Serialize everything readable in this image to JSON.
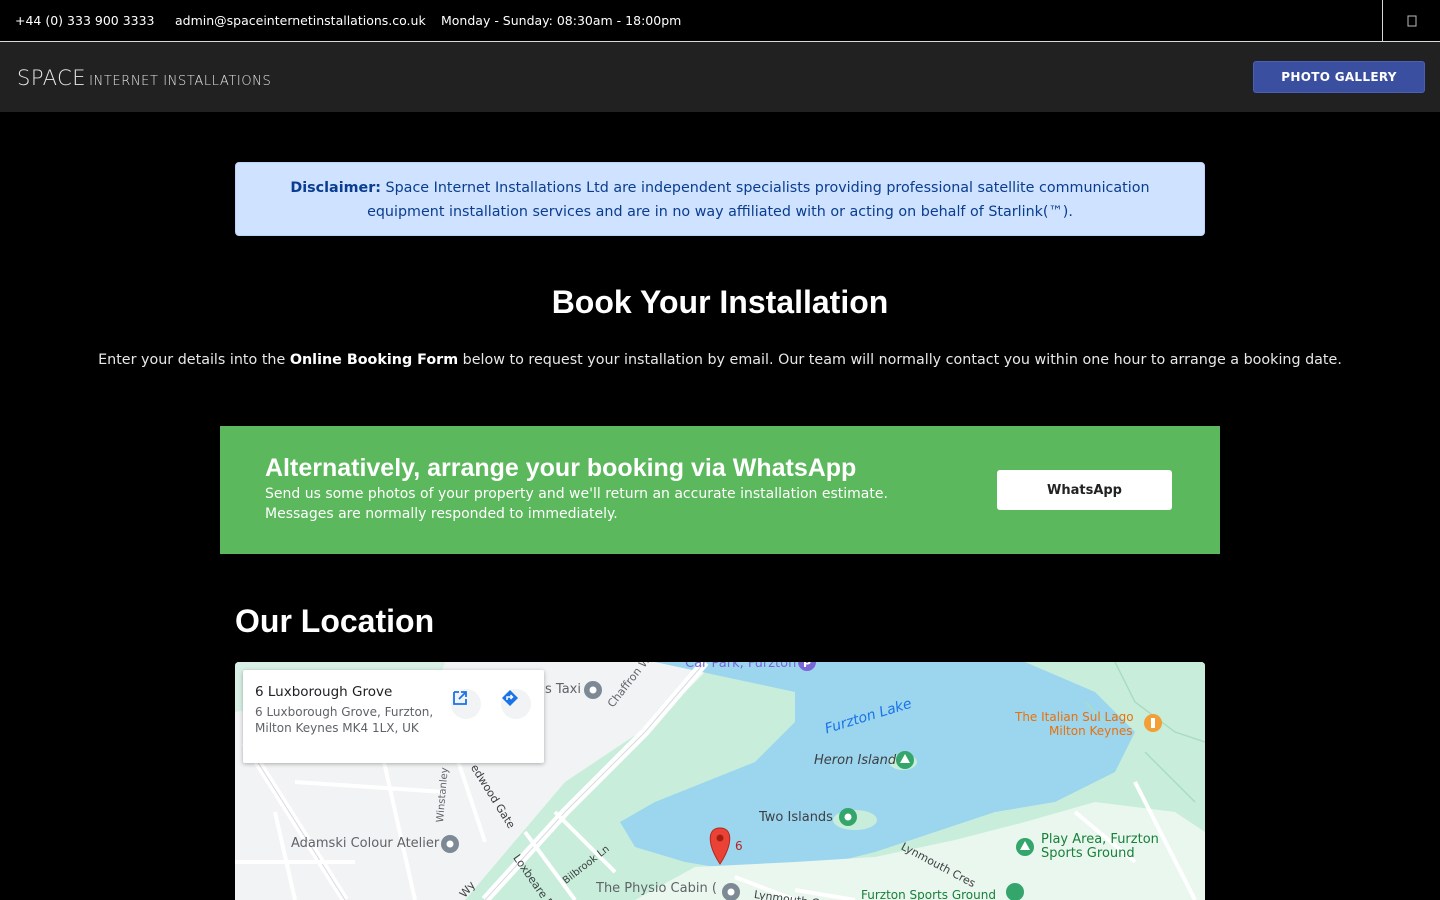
{
  "topbar": {
    "phone": "+44 (0) 333 900 3333",
    "email": "admin@spaceinternetinstallations.co.uk",
    "hours": "Monday - Sunday: 08:30am - 18:00pm",
    "social_icon": "icon"
  },
  "header": {
    "logo_big": "SPACE",
    "logo_small": "INTERNET INSTALLATIONS",
    "gallery_button": "PHOTO GALLERY"
  },
  "disclaimer": {
    "label": "Disclaimer:",
    "text": " Space Internet Installations Ltd are independent specialists providing professional satellite communication equipment installation services and are in no way affiliated with or acting on behalf of Starlink(™)."
  },
  "booking": {
    "title": "Book Your Installation",
    "desc_before": "Enter your details into the ",
    "desc_strong": "Online Booking Form",
    "desc_after": " below to request your installation by email. Our team will normally contact you within one hour to arrange a booking date."
  },
  "whatsapp": {
    "title": "Alternatively, arrange your booking via WhatsApp",
    "line1": "Send us some photos of your property and we'll return an accurate installation estimate.",
    "line2": "Messages are normally responded to immediately.",
    "button": "WhatsApp"
  },
  "location": {
    "title": "Our Location",
    "card_title": "6 Luxborough Grove",
    "card_address": "6 Luxborough Grove, Furzton, Milton Keynes MK4 1LX, UK",
    "labels": {
      "car_park": "Car Park, Furzton",
      "taxi": "s Taxi",
      "chaffron": "Chaffron Wy",
      "furzton_lake": "Furzton Lake",
      "italian_1": "The Italian Sul Lago",
      "italian_2": "Milton Keynes",
      "heron_island": "Heron Island",
      "two_islands": "Two Islands",
      "play_area_1": "Play Area, Furzton",
      "play_area_2": "Sports Ground",
      "lynmouth": "Lynmouth Cres",
      "adamski": "Adamski Colour Atelier",
      "winstanley": "Winstanley",
      "redwood": "edwood Gate",
      "bilbrook": "Bilbrook Ln",
      "loxbeare": "Loxbeare D",
      "physio": "The Physio Cabin (",
      "sports_ground": "Furzton Sports Ground",
      "lynmouth2": "Lynmouth Cres",
      "pin_label": "6",
      "wy": "Wy",
      "p": "P"
    }
  },
  "colors": {
    "disclaimer_bg": "#cfe2ff",
    "disclaimer_text": "#0a3d8f",
    "whatsapp_bg": "#5cb85c",
    "gallery_btn": "#3b4fa0",
    "map_water": "#9cd5ee",
    "map_park": "#c8eedb"
  }
}
